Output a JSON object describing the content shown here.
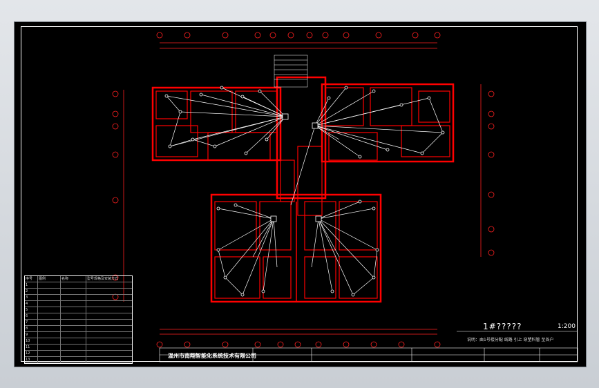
{
  "drawing": {
    "title": "1#?????",
    "scale": "1:200",
    "note": "说明：由1号楼分配 线路 引上 穿塑料管 至各户",
    "company": "温州市南翔智能化系统技术有限公司"
  },
  "legend": {
    "headers": [
      "序号",
      "图例",
      "名称",
      "型号规格及安装方式"
    ],
    "rows": [
      [
        "1",
        "",
        "",
        ""
      ],
      [
        "2",
        "",
        "",
        ""
      ],
      [
        "3",
        "",
        "",
        ""
      ],
      [
        "4",
        "",
        "",
        ""
      ],
      [
        "5",
        "",
        "",
        ""
      ],
      [
        "6",
        "",
        "",
        ""
      ],
      [
        "7",
        "",
        "",
        ""
      ],
      [
        "8",
        "",
        "",
        ""
      ],
      [
        "9",
        "",
        "",
        ""
      ],
      [
        "10",
        "",
        "",
        ""
      ],
      [
        "11",
        "",
        "",
        ""
      ],
      [
        "12",
        "",
        "",
        ""
      ],
      [
        "13",
        "",
        "",
        ""
      ]
    ]
  },
  "colors": {
    "background": "#000000",
    "walls": "#ff0000",
    "wiring": "#ffffff",
    "frame": "#ffffff"
  }
}
